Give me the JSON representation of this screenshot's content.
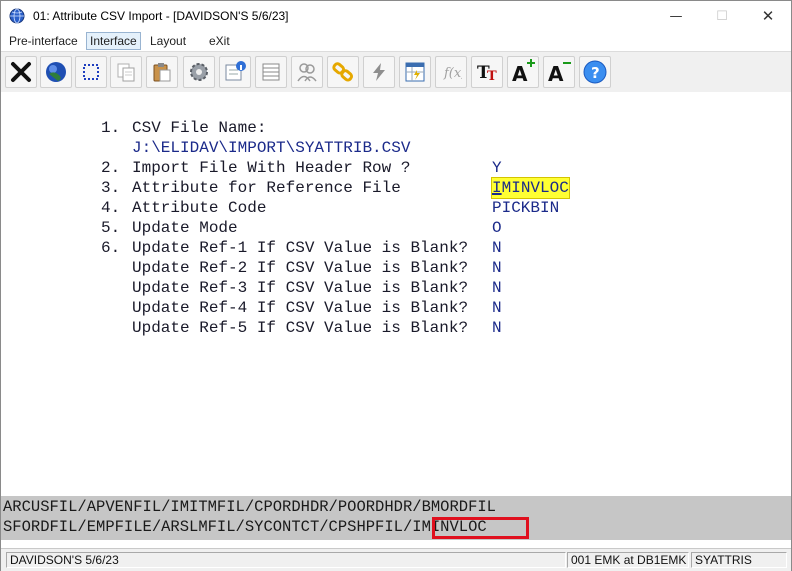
{
  "window": {
    "title": "01: Attribute CSV Import - [DAVIDSON'S 5/6/23]",
    "minimize_glyph": "—",
    "maximize_glyph": "☐",
    "close_glyph": "✕"
  },
  "menu": [
    {
      "label": "Pre-interface"
    },
    {
      "label": "Interface",
      "active": true
    },
    {
      "label": "Layout"
    },
    {
      "label": "eXit"
    }
  ],
  "toolbar_icons": [
    "close-x-icon",
    "globe-icon",
    "select-dotted-icon",
    "copy-icon",
    "paste-icon",
    "settings-gear-icon",
    "properties-icon",
    "list-icon",
    "users-icon",
    "link-chain-icon",
    "lightning-icon",
    "spreadsheet-icon",
    "formula-icon",
    "text-style-icon",
    "font-increase-icon",
    "font-decrease-icon",
    "help-icon"
  ],
  "form": {
    "fields": [
      {
        "num": "1.",
        "label": "CSV File Name:",
        "value": ""
      },
      {
        "num": "",
        "label": "J:\\ELIDAV\\IMPORT\\SYATTRIB.CSV",
        "value": ""
      },
      {
        "num": "2.",
        "label": "Import File With Header Row ?",
        "value": "Y"
      },
      {
        "num": "3.",
        "label": "Attribute for Reference File",
        "value": "IMINVLOC"
      },
      {
        "num": "4.",
        "label": "Attribute Code",
        "value": "PICKBIN"
      },
      {
        "num": "5.",
        "label": "Update Mode",
        "value": "O"
      },
      {
        "num": "6.",
        "label": "Update Ref-1 If CSV Value is Blank?",
        "value": "N"
      },
      {
        "num": "",
        "label": "Update Ref-2 If CSV Value is Blank?",
        "value": "N"
      },
      {
        "num": "",
        "label": "Update Ref-3 If CSV Value is Blank?",
        "value": "N"
      },
      {
        "num": "",
        "label": "Update Ref-4 If CSV Value is Blank?",
        "value": "N"
      },
      {
        "num": "",
        "label": "Update Ref-5 If CSV Value is Blank?",
        "value": "N"
      }
    ],
    "active_field_cursor_char": "I",
    "active_field_rest": "MINVLOC"
  },
  "lookup": {
    "line1": "ARCUSFIL/APVENFIL/IMITMFIL/CPORDHDR/POORDHDR/BMORDFIL",
    "line2_prefix": "SFORDFIL/EMPFILE/ARSLMFIL/SYCONTCT/CPSHPFIL/",
    "line2_selected": "IMINVLOC",
    "selection_color": "#e0101e"
  },
  "status": {
    "company": "DAVIDSON'S 5/6/23",
    "user": "001 EMK at DB1EMK",
    "program": "SYATTRIS"
  }
}
